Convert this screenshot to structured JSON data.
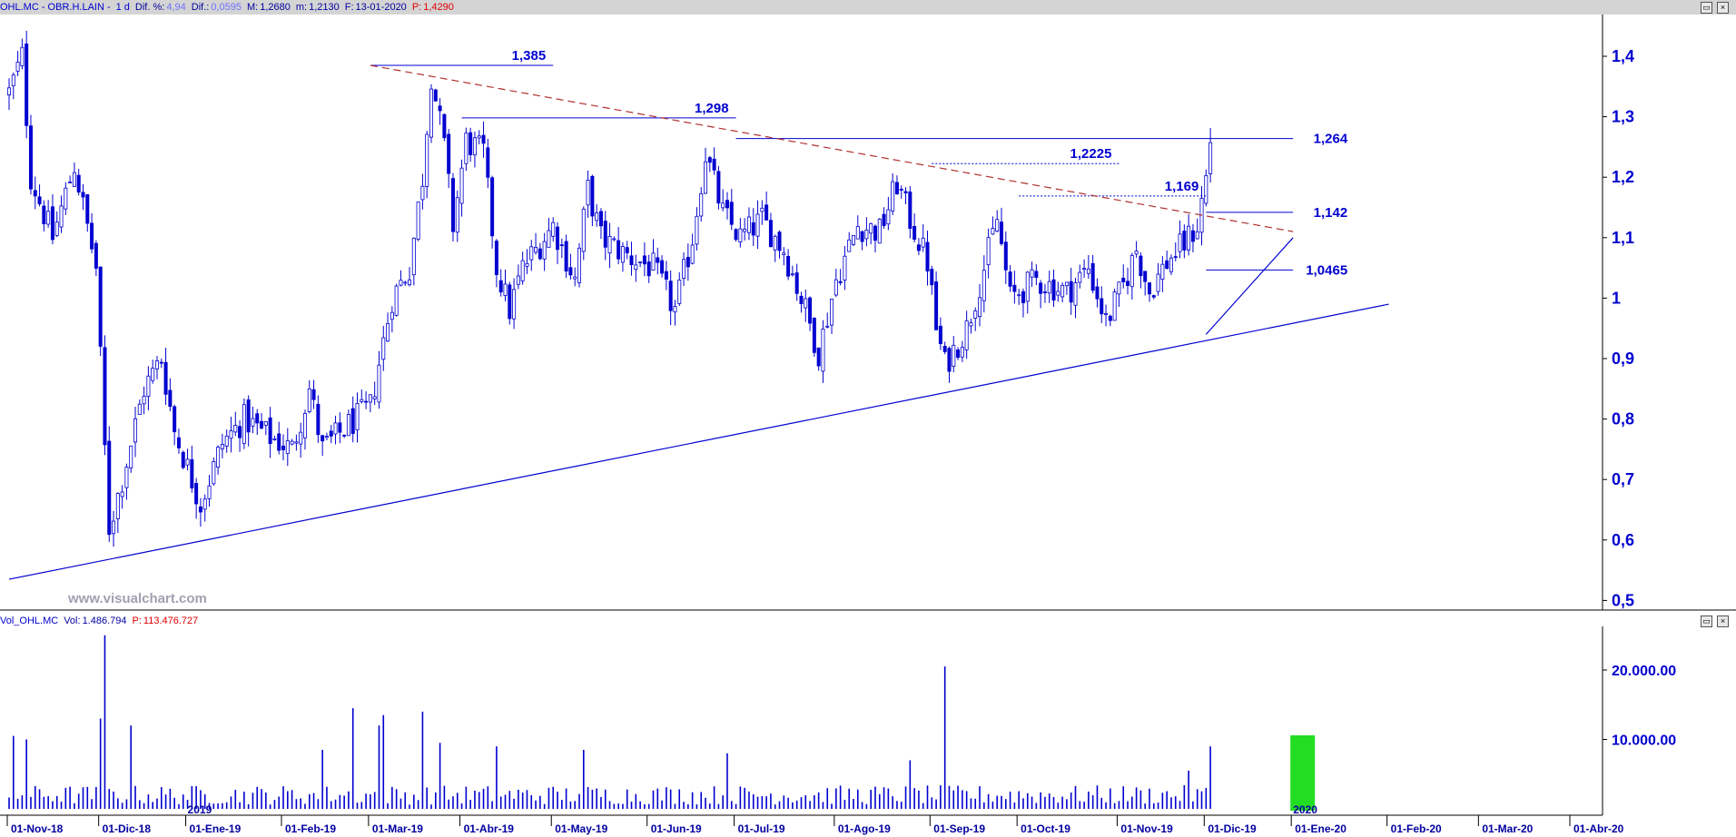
{
  "price_header": {
    "symbol": "OHL.MC - OBR.H.LAIN -",
    "interval": "1 d",
    "dif_pct_label": "Dif. %:",
    "dif_pct": "4,94",
    "dif_label": "Dif.:",
    "dif": "0,0595",
    "max_label": "M:",
    "max": "1,2680",
    "min_label": "m:",
    "min": "1,2130",
    "date_label": "F:",
    "date": "13-01-2020",
    "price_label": "P:",
    "price": "1,4290"
  },
  "volume_header": {
    "symbol": "Vol_OHL.MC",
    "vol_label": "Vol:",
    "vol": "1.486.794",
    "p_label": "P:",
    "p": "113.476.727"
  },
  "watermark": "www.visualchart.com",
  "colors": {
    "candle": "#0000d0",
    "background": "#ffffff",
    "header": "#d4d4d4",
    "trend_dashed": "#b03030",
    "highlight": "#22dd22"
  },
  "chart_data": [
    {
      "type": "candlestick",
      "title": "",
      "y_axis_ticks": [
        "1,4",
        "1,3",
        "1,2",
        "1,1",
        "1",
        "0,9",
        "0,8",
        "0,7",
        "0,6",
        "0,5"
      ],
      "ylim": [
        0.48,
        1.48
      ],
      "x_axis_ticks": [
        "01-Nov-18",
        "01-Dic-18",
        "01-Ene-19",
        "01-Feb-19",
        "01-Mar-19",
        "01-Abr-19",
        "01-May-19",
        "01-Jun-19",
        "01-Jul-19",
        "01-Ago-19",
        "01-Sep-19",
        "01-Oct-19",
        "01-Nov-19",
        "01-Dic-19",
        "01-Ene-20",
        "01-Feb-20",
        "01-Mar-20",
        "01-Abr-20"
      ],
      "year_markers": [
        "2019",
        "2020"
      ],
      "anchors": [
        {
          "d": 0,
          "p": 1.34
        },
        {
          "d": 3,
          "p": 1.4
        },
        {
          "d": 5,
          "p": 1.2
        },
        {
          "d": 10,
          "p": 1.1
        },
        {
          "d": 15,
          "p": 1.22
        },
        {
          "d": 20,
          "p": 1.05
        },
        {
          "d": 22,
          "p": 0.75
        },
        {
          "d": 23,
          "p": 0.62
        },
        {
          "d": 26,
          "p": 0.7
        },
        {
          "d": 31,
          "p": 0.85
        },
        {
          "d": 35,
          "p": 0.9
        },
        {
          "d": 38,
          "p": 0.78
        },
        {
          "d": 44,
          "p": 0.66
        },
        {
          "d": 49,
          "p": 0.76
        },
        {
          "d": 54,
          "p": 0.8
        },
        {
          "d": 60,
          "p": 0.77
        },
        {
          "d": 65,
          "p": 0.75
        },
        {
          "d": 69,
          "p": 0.85
        },
        {
          "d": 72,
          "p": 0.75
        },
        {
          "d": 78,
          "p": 0.79
        },
        {
          "d": 83,
          "p": 0.82
        },
        {
          "d": 88,
          "p": 1.0
        },
        {
          "d": 92,
          "p": 1.05
        },
        {
          "d": 95,
          "p": 1.2
        },
        {
          "d": 97,
          "p": 1.37
        },
        {
          "d": 100,
          "p": 1.25
        },
        {
          "d": 102,
          "p": 1.12
        },
        {
          "d": 105,
          "p": 1.26
        },
        {
          "d": 109,
          "p": 1.24
        },
        {
          "d": 112,
          "p": 1.05
        },
        {
          "d": 115,
          "p": 0.98
        },
        {
          "d": 118,
          "p": 1.05
        },
        {
          "d": 125,
          "p": 1.12
        },
        {
          "d": 130,
          "p": 1.03
        },
        {
          "d": 133,
          "p": 1.18
        },
        {
          "d": 136,
          "p": 1.1
        },
        {
          "d": 142,
          "p": 1.07
        },
        {
          "d": 148,
          "p": 1.05
        },
        {
          "d": 153,
          "p": 0.98
        },
        {
          "d": 157,
          "p": 1.1
        },
        {
          "d": 160,
          "p": 1.24
        },
        {
          "d": 164,
          "p": 1.14
        },
        {
          "d": 168,
          "p": 1.1
        },
        {
          "d": 173,
          "p": 1.13
        },
        {
          "d": 178,
          "p": 1.08
        },
        {
          "d": 183,
          "p": 0.98
        },
        {
          "d": 186,
          "p": 0.91
        },
        {
          "d": 190,
          "p": 1.03
        },
        {
          "d": 195,
          "p": 1.12
        },
        {
          "d": 200,
          "p": 1.11
        },
        {
          "d": 204,
          "p": 1.19
        },
        {
          "d": 207,
          "p": 1.13
        },
        {
          "d": 211,
          "p": 1.06
        },
        {
          "d": 213,
          "p": 0.95
        },
        {
          "d": 215,
          "p": 0.89
        },
        {
          "d": 220,
          "p": 0.95
        },
        {
          "d": 224,
          "p": 1.05
        },
        {
          "d": 227,
          "p": 1.13
        },
        {
          "d": 230,
          "p": 1.0
        },
        {
          "d": 236,
          "p": 1.03
        },
        {
          "d": 243,
          "p": 1.01
        },
        {
          "d": 248,
          "p": 1.05
        },
        {
          "d": 252,
          "p": 0.96
        },
        {
          "d": 256,
          "p": 1.02
        },
        {
          "d": 259,
          "p": 1.08
        },
        {
          "d": 262,
          "p": 1.01
        },
        {
          "d": 266,
          "p": 1.06
        },
        {
          "d": 270,
          "p": 1.09
        },
        {
          "d": 273,
          "p": 1.12
        },
        {
          "d": 275,
          "p": 1.2
        },
        {
          "d": 276,
          "p": 1.26
        }
      ],
      "date_ticks": [
        {
          "label": "01-Nov-18",
          "d": 0
        },
        {
          "label": "01-Dic-18",
          "d": 21
        },
        {
          "label": "01-Ene-19",
          "d": 41
        },
        {
          "label": "01-Feb-19",
          "d": 63
        },
        {
          "label": "01-Mar-19",
          "d": 83
        },
        {
          "label": "01-Abr-19",
          "d": 104
        },
        {
          "label": "01-May-19",
          "d": 125
        },
        {
          "label": "01-Jun-19",
          "d": 147
        },
        {
          "label": "01-Jul-19",
          "d": 167
        },
        {
          "label": "01-Ago-19",
          "d": 190
        },
        {
          "label": "01-Sep-19",
          "d": 212
        },
        {
          "label": "01-Oct-19",
          "d": 232
        },
        {
          "label": "01-Nov-19",
          "d": 255
        },
        {
          "label": "01-Dic-19",
          "d": 275
        },
        {
          "label": "01-Ene-20",
          "d": 295
        },
        {
          "label": "01-Feb-20",
          "d": 317
        },
        {
          "label": "01-Mar-20",
          "d": 338
        },
        {
          "label": "01-Abr-20",
          "d": 359
        }
      ],
      "levels": [
        {
          "label": "1,385",
          "value": 1.385,
          "style": "solid",
          "from_date": "01-Mar-19",
          "to_date": "01-May-19"
        },
        {
          "label": "1,298",
          "value": 1.298,
          "style": "solid",
          "from_date": "01-Abr-19",
          "to_date": "01-Jul-19"
        },
        {
          "label": "1,264",
          "value": 1.264,
          "style": "solid",
          "from_date": "01-Jul-19",
          "to_date": "01-Ene-20"
        },
        {
          "label": "1,2225",
          "value": 1.2225,
          "style": "dotted",
          "from_date": "01-Sep-19",
          "to_date": "01-Nov-19"
        },
        {
          "label": "1,169",
          "value": 1.169,
          "style": "dotted",
          "from_date": "01-Oct-19",
          "to_date": "01-Dic-19"
        },
        {
          "label": "1,142",
          "value": 1.142,
          "style": "solid",
          "from_date": "01-Dic-19",
          "to_date": "01-Ene-20"
        },
        {
          "label": "1,0465",
          "value": 1.0465,
          "style": "solid",
          "from_date": "01-Dic-19",
          "to_date": "01-Ene-20"
        }
      ],
      "trendlines": [
        {
          "style": "dashed",
          "from": {
            "date": "01-Mar-19",
            "value": 1.385
          },
          "to": {
            "date": "01-Ene-20",
            "value": 1.11
          }
        },
        {
          "style": "solid",
          "from": {
            "date": "01-Nov-18",
            "value": 0.535
          },
          "to": {
            "date": "01-Feb-20",
            "value": 0.99
          }
        },
        {
          "style": "solid",
          "from": {
            "date": "01-Dic-19",
            "value": 0.94
          },
          "to": {
            "date": "01-Ene-20",
            "value": 1.1
          }
        }
      ]
    },
    {
      "type": "bar",
      "title": "",
      "y_axis_ticks": [
        "20.000.00",
        "10.000.00"
      ],
      "ylim": [
        0,
        27000
      ],
      "highlight_range": {
        "from_date": "01-Ene-20",
        "to_date": "13-01-2020"
      },
      "spikes": [
        {
          "d": 22,
          "v": 25000
        },
        {
          "d": 21,
          "v": 13000
        },
        {
          "d": 28,
          "v": 12000
        },
        {
          "d": 79,
          "v": 14500
        },
        {
          "d": 85,
          "v": 12000
        },
        {
          "d": 86,
          "v": 13500
        },
        {
          "d": 95,
          "v": 14000
        },
        {
          "d": 99,
          "v": 9500
        },
        {
          "d": 112,
          "v": 9000
        },
        {
          "d": 132,
          "v": 8500
        },
        {
          "d": 165,
          "v": 8000
        },
        {
          "d": 215,
          "v": 20500
        },
        {
          "d": 207,
          "v": 7000
        },
        {
          "d": 4,
          "v": 10000
        },
        {
          "d": 1,
          "v": 10500
        },
        {
          "d": 72,
          "v": 8500
        },
        {
          "d": 276,
          "v": 9000
        },
        {
          "d": 271,
          "v": 5500
        }
      ]
    }
  ]
}
